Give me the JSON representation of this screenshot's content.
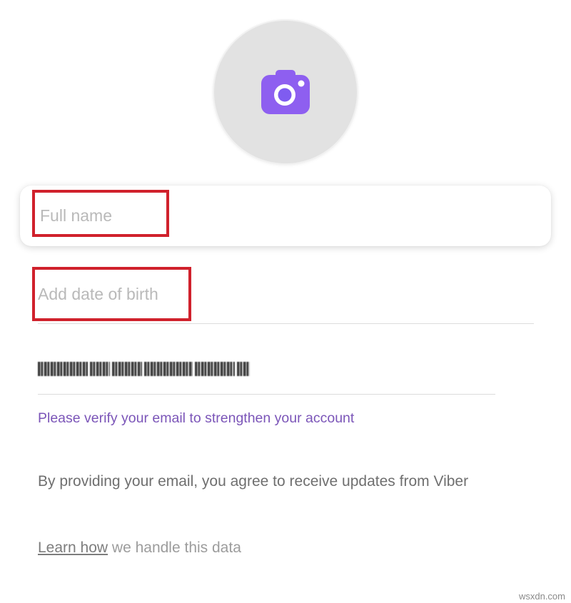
{
  "profile": {
    "avatar_icon": "camera-icon",
    "accent_color": "#7360f2"
  },
  "form": {
    "full_name_placeholder": "Full name",
    "full_name_value": "",
    "dob_placeholder": "Add date of birth",
    "email_value": "",
    "verify_email_text": "Please verify your email to strengthen your account",
    "agree_text": "By providing your email, you agree to receive updates from Viber",
    "learn_how_link": "Learn how",
    "learn_how_suffix": " we handle this data"
  },
  "annotations": {
    "highlight_color": "#d0212c"
  },
  "watermark": "wsxdn.com"
}
